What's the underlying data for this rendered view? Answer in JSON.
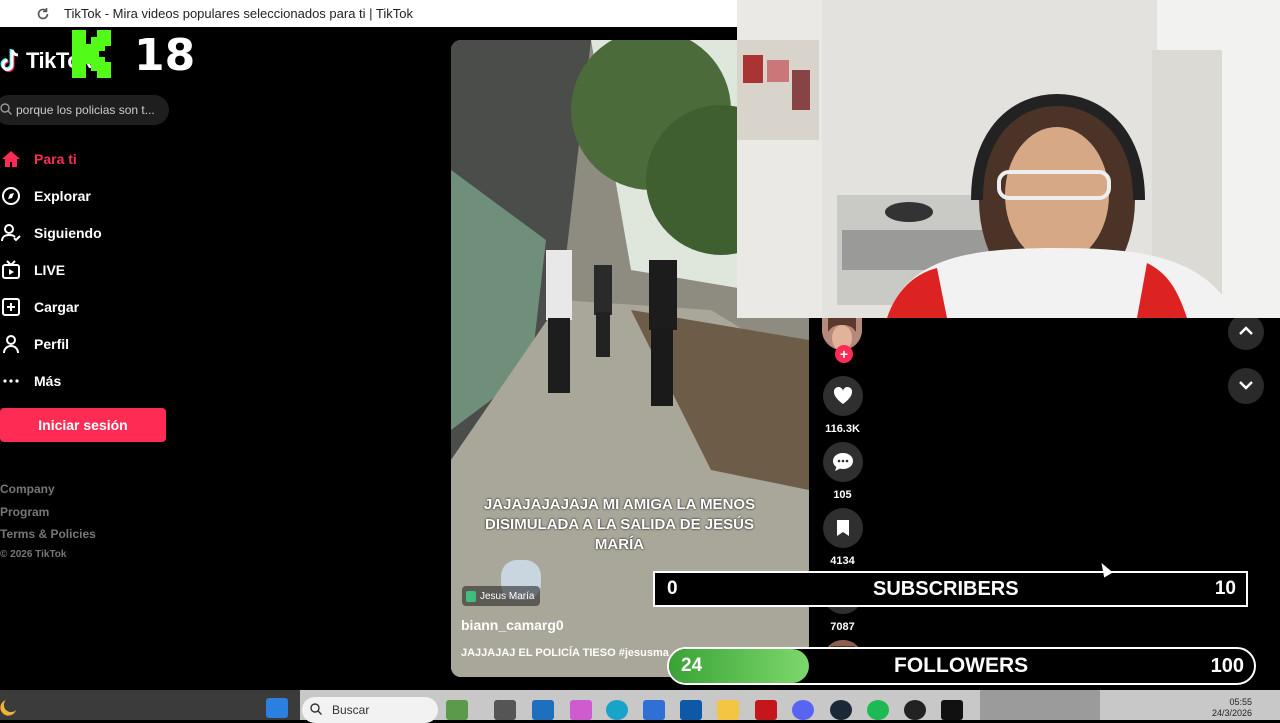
{
  "browser": {
    "tab_title": "TikTok - Mira videos populares seleccionados para ti | TikTok"
  },
  "overlay": {
    "age_badge": "18"
  },
  "logo": {
    "text": "TikTok"
  },
  "search": {
    "value": "porque los policias son t..."
  },
  "nav": {
    "items": [
      {
        "label": "Para ti",
        "icon": "home-icon"
      },
      {
        "label": "Explorar",
        "icon": "compass-icon"
      },
      {
        "label": "Siguiendo",
        "icon": "following-icon"
      },
      {
        "label": "LIVE",
        "icon": "live-icon"
      },
      {
        "label": "Cargar",
        "icon": "upload-icon"
      },
      {
        "label": "Perfil",
        "icon": "profile-icon"
      },
      {
        "label": "Más",
        "icon": "more-icon"
      }
    ],
    "login_label": "Iniciar sesión"
  },
  "footer": {
    "company": "Company",
    "program": "Program",
    "terms": "Terms & Policies",
    "copyright": "© 2026 TikTok"
  },
  "video": {
    "caption": "JAJAJAJAJAJA MI AMIGA LA MENOS DISIMULADA A LA SALIDA DE JESÚS MARÍA",
    "location": "Jesus María",
    "author": "biann_camarg0",
    "description": "JAJJAJAJ EL POLICÍA TIESO #jesusma"
  },
  "actions": {
    "likes": "116.3K",
    "comments": "105",
    "saves": "4134",
    "shares": "7087"
  },
  "subscribers": {
    "current": "0",
    "label": "SUBSCRIBERS",
    "goal": "10"
  },
  "followers": {
    "current": "24",
    "label": "FOLLOWERS",
    "goal": "100",
    "progress": 0.24
  },
  "taskbar": {
    "search_placeholder": "Buscar",
    "time": "05:55",
    "date": "24/3/2026"
  },
  "colors": {
    "accent": "#fe2c55",
    "progress": "#5cc24f"
  }
}
